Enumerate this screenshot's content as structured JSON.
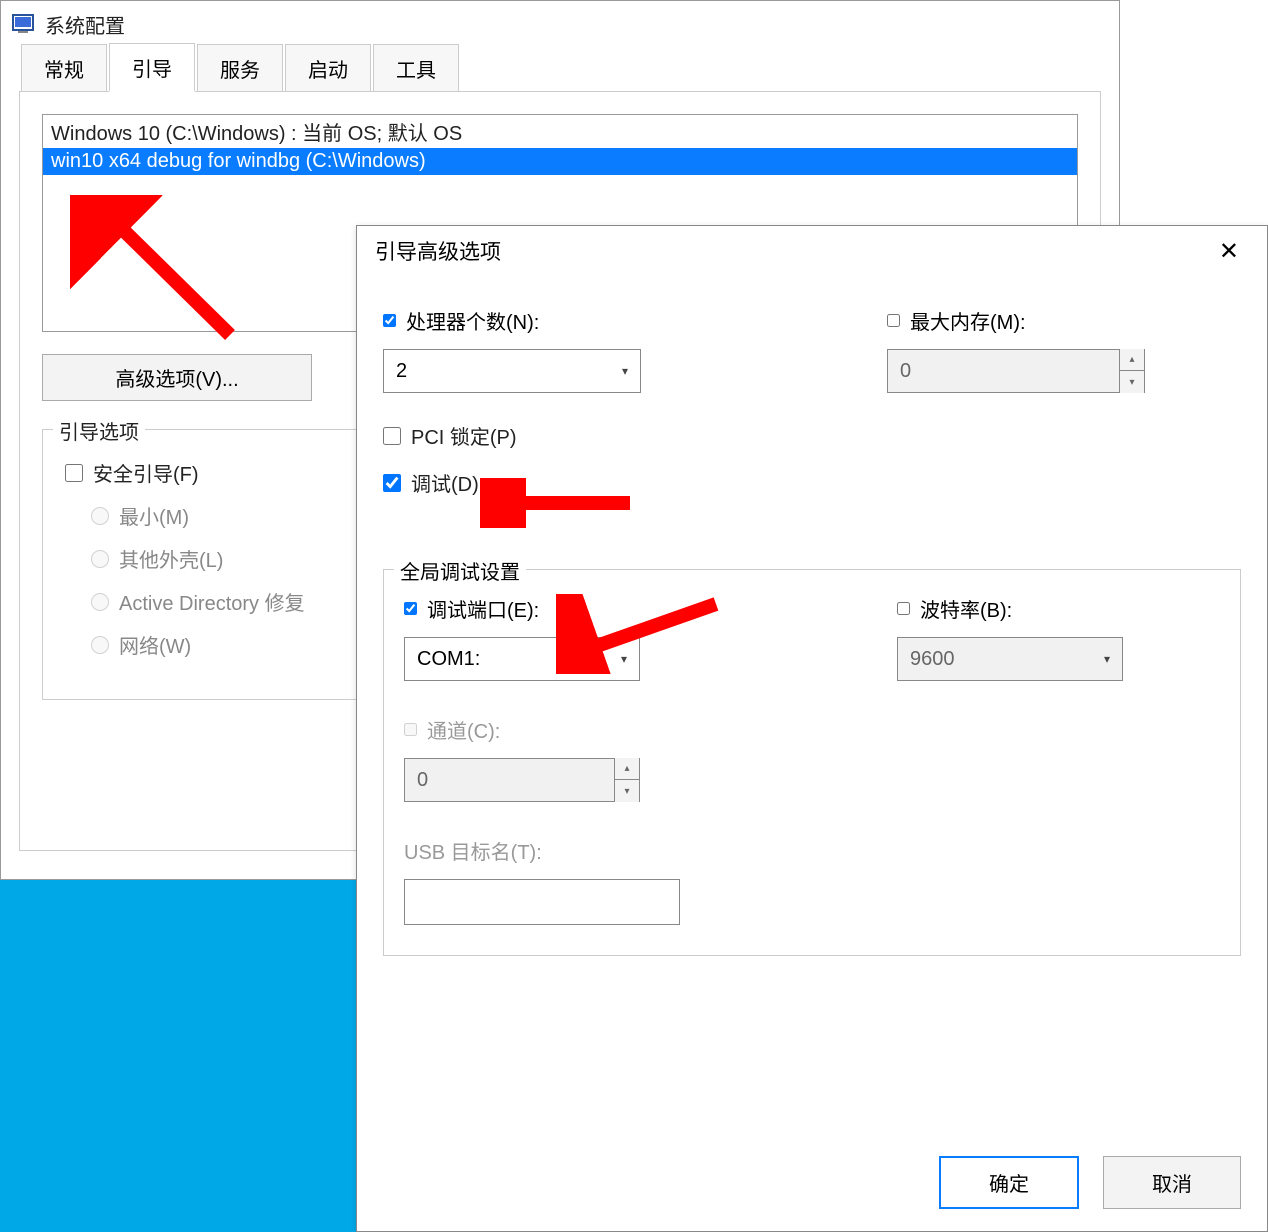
{
  "main": {
    "title": "系统配置",
    "tabs": [
      "常规",
      "引导",
      "服务",
      "启动",
      "工具"
    ],
    "active_tab": 1,
    "boot_entries": [
      "Windows 10 (C:\\Windows) : 当前 OS; 默认 OS",
      "win10 x64 debug for windbg (C:\\Windows)"
    ],
    "selected_entry": 1,
    "btn_advanced": "高级选项(V)...",
    "boot_options_legend": "引导选项",
    "safe_boot": "安全引导(F)",
    "radio_min": "最小(M)",
    "radio_shell": "其他外壳(L)",
    "radio_ad": "Active Directory 修复",
    "radio_net": "网络(W)"
  },
  "adv": {
    "title": "引导高级选项",
    "num_proc_label": "处理器个数(N):",
    "num_proc_value": "2",
    "max_mem_label": "最大内存(M):",
    "max_mem_value": "0",
    "pci_lock": "PCI 锁定(P)",
    "debug_label": "调试(D)",
    "global_legend": "全局调试设置",
    "debug_port_label": "调试端口(E):",
    "debug_port_value": "COM1:",
    "baud_label": "波特率(B):",
    "baud_value": "9600",
    "channel_label": "通道(C):",
    "channel_value": "0",
    "usb_label": "USB 目标名(T):",
    "usb_value": "",
    "ok": "确定",
    "cancel": "取消"
  }
}
